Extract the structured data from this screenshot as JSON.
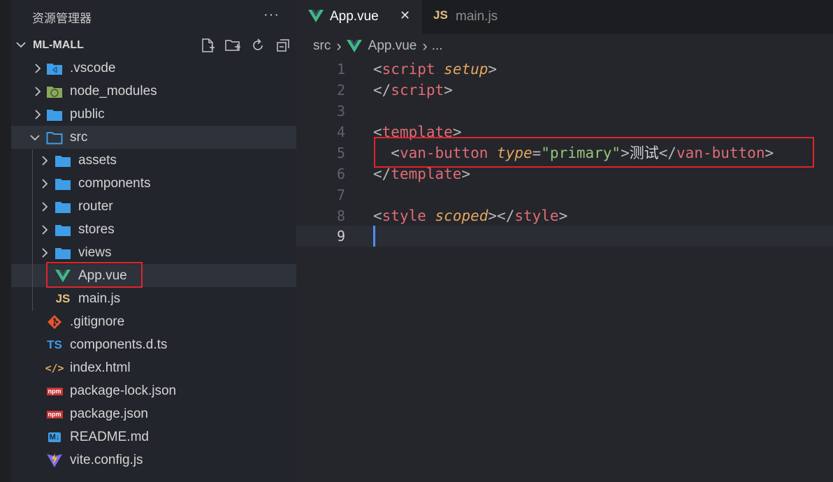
{
  "explorer": {
    "title": "资源管理器",
    "more": "···",
    "project": "ML-MALL",
    "items": [
      {
        "label": ".vscode",
        "icon": "vscode-folder-icon"
      },
      {
        "label": "node_modules",
        "icon": "node-folder-icon"
      },
      {
        "label": "public",
        "icon": "folder-icon"
      },
      {
        "label": "src",
        "icon": "folder-open-icon"
      },
      {
        "label": "assets",
        "icon": "folder-icon"
      },
      {
        "label": "components",
        "icon": "folder-icon"
      },
      {
        "label": "router",
        "icon": "folder-icon"
      },
      {
        "label": "stores",
        "icon": "folder-icon"
      },
      {
        "label": "views",
        "icon": "folder-icon"
      },
      {
        "label": "App.vue",
        "icon": "vue-icon"
      },
      {
        "label": "main.js",
        "icon": "js-icon"
      },
      {
        "label": ".gitignore",
        "icon": "git-icon"
      },
      {
        "label": "components.d.ts",
        "icon": "ts-icon"
      },
      {
        "label": "index.html",
        "icon": "html-icon"
      },
      {
        "label": "package-lock.json",
        "icon": "npm-icon"
      },
      {
        "label": "package.json",
        "icon": "npm-icon"
      },
      {
        "label": "README.md",
        "icon": "markdown-icon"
      },
      {
        "label": "vite.config.js",
        "icon": "vite-icon"
      }
    ]
  },
  "tabs": [
    {
      "label": "App.vue",
      "close": "✕",
      "active": true
    },
    {
      "label": "main.js",
      "active": false
    }
  ],
  "breadcrumb": {
    "folder": "src",
    "file": "App.vue",
    "sep": "›",
    "ellipsis": "..."
  },
  "icons": {
    "js": "JS",
    "ts": "TS",
    "npm": "npm",
    "md": "M↓",
    "html": "</>"
  },
  "editor": {
    "line_numbers": [
      "1",
      "2",
      "3",
      "4",
      "5",
      "6",
      "7",
      "8",
      "9"
    ],
    "current_line": 9,
    "tokens": {
      "l1_open": "<",
      "l1_tag": "script",
      "l1_attr": "setup",
      "l1_close": ">",
      "l2_open": "</",
      "l2_tag": "script",
      "l2_close": ">",
      "l4_open": "<",
      "l4_tag": "template",
      "l4_close": ">",
      "l5_open": "<",
      "l5_tag": "van-button",
      "l5_attr": "type",
      "l5_eq": "=",
      "l5_str": "\"primary\"",
      "l5_gt": ">",
      "l5_text": "测试",
      "l5_close_open": "</",
      "l5_close_tag": "van-button",
      "l5_close": ">",
      "l6_open": "</",
      "l6_tag": "template",
      "l6_close": ">",
      "l8_open": "<",
      "l8_tag": "style",
      "l8_attr": "scoped",
      "l8_gt": ">",
      "l8_close_open": "</",
      "l8_close_tag": "style",
      "l8_close": ">"
    }
  },
  "colors": {
    "highlight_box": "#e0242b",
    "vue_green": "#41b883",
    "folder_blue": "#3f9de8",
    "tag_red": "#e06c75",
    "attr_orange": "#e5a65e",
    "string_green": "#98c379"
  }
}
